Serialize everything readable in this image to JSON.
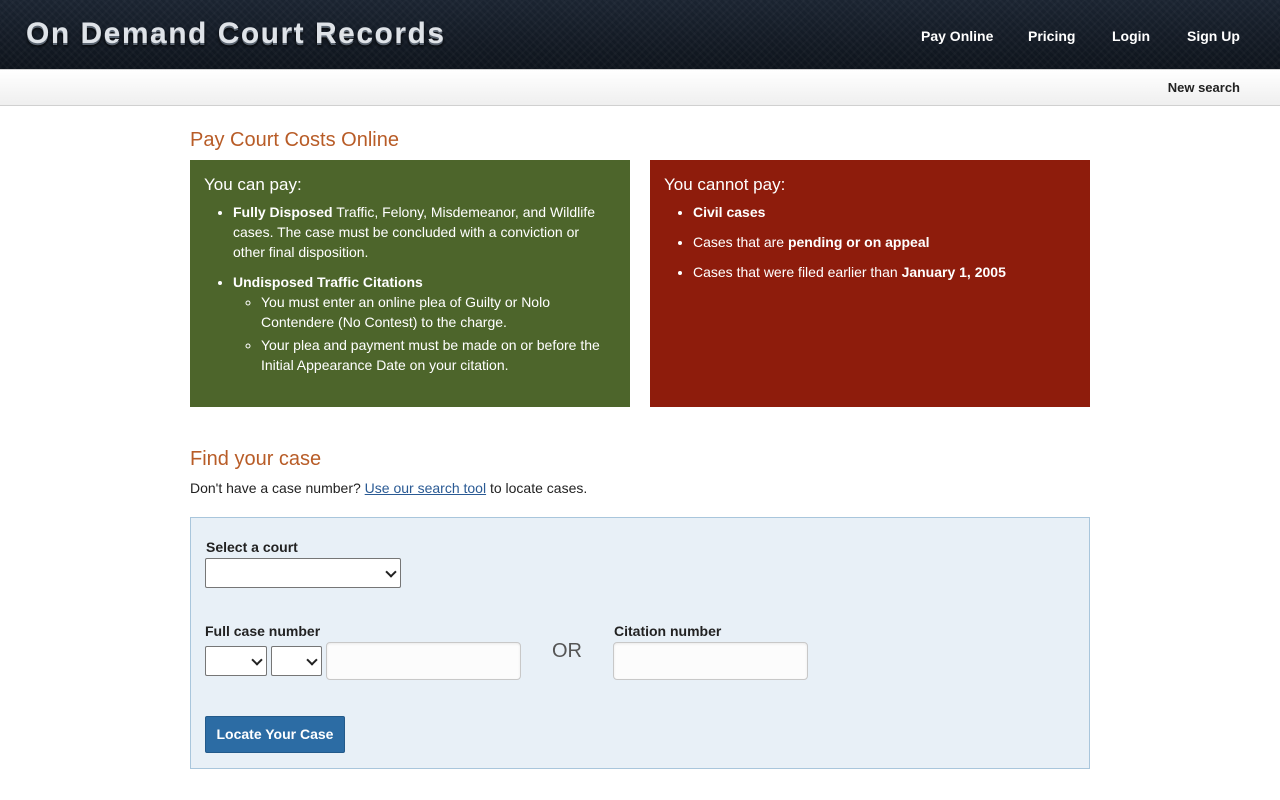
{
  "header": {
    "logo": "On Demand Court Records",
    "nav": [
      "Pay Online",
      "Pricing",
      "Login",
      "Sign Up"
    ]
  },
  "subnav": {
    "new_search": "New search"
  },
  "pay_section": {
    "title": "Pay Court Costs Online",
    "can_pay": {
      "title": "You can pay:",
      "fully_disposed_bold": "Fully Disposed",
      "fully_disposed_text": " Traffic, Felony, Misdemeanor, and Wildlife cases. The case must be concluded with a conviction or other final disposition.",
      "undisposed_bold": "Undisposed Traffic Citations",
      "undisposed_items": [
        "You must enter an online plea of Guilty or Nolo Contendere (No Contest) to the charge.",
        "Your plea and payment must be made on or before the Initial Appearance Date on your citation."
      ]
    },
    "cannot_pay": {
      "title": "You cannot pay:",
      "civil": "Civil cases",
      "pending_pre": "Cases that are ",
      "pending_bold": "pending or on appeal",
      "filed_pre": "Cases that were filed earlier than ",
      "filed_bold": "January 1, 2005"
    }
  },
  "find_section": {
    "title": "Find your case",
    "text_pre": "Don't have a case number? ",
    "link": "Use our search tool",
    "text_post": " to locate cases.",
    "select_court_label": "Select a court",
    "select_court_value": "",
    "case_number_label": "Full case number",
    "case_year_value": "",
    "case_type_value": "",
    "case_number_value": "",
    "or_text": "OR",
    "citation_label": "Citation number",
    "citation_value": "",
    "submit": "Locate Your Case"
  },
  "colors": {
    "accent_heading": "#b85c27",
    "can_pay_panel": "#4d652b",
    "cannot_pay_panel": "#8e1c0c",
    "button": "#2c6ca4",
    "form_bg": "#e8f0f7"
  }
}
